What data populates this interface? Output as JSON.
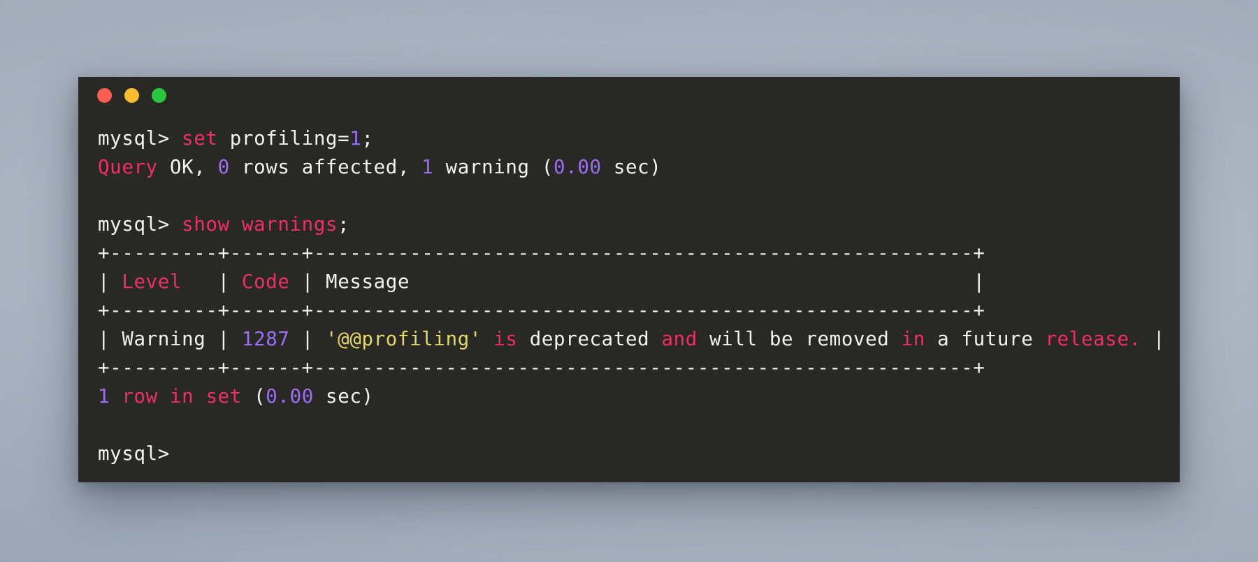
{
  "window": {
    "app": "Terminal",
    "background_color": "#282824",
    "controls": [
      {
        "name": "close",
        "color": "#ff5e52"
      },
      {
        "name": "minimize",
        "color": "#fbbd2e"
      },
      {
        "name": "maximize",
        "color": "#28c83e"
      }
    ]
  },
  "theme": {
    "foreground": "#f2f2ee",
    "keyword": "#ef2e63",
    "number": "#9b6ef3",
    "string": "#e5d769",
    "desktop": "#a5b0bd"
  },
  "terminal": {
    "prompt": "mysql>",
    "lines": [
      {
        "id": "cmd-set-profiling",
        "segments": [
          {
            "text": "mysql> ",
            "style": "pl"
          },
          {
            "text": "set",
            "style": "kw"
          },
          {
            "text": " profiling=",
            "style": "pl"
          },
          {
            "text": "1",
            "style": "num"
          },
          {
            "text": ";",
            "style": "pl"
          }
        ]
      },
      {
        "id": "result-query-ok",
        "segments": [
          {
            "text": "Query",
            "style": "kw"
          },
          {
            "text": " OK, ",
            "style": "pl"
          },
          {
            "text": "0",
            "style": "num"
          },
          {
            "text": " rows affected, ",
            "style": "pl"
          },
          {
            "text": "1",
            "style": "num"
          },
          {
            "text": " warning (",
            "style": "pl"
          },
          {
            "text": "0.00",
            "style": "num"
          },
          {
            "text": " sec)",
            "style": "pl"
          }
        ]
      },
      {
        "id": "blank-1",
        "segments": [
          {
            "text": " ",
            "style": "pl"
          }
        ]
      },
      {
        "id": "cmd-show-warnings",
        "segments": [
          {
            "text": "mysql> ",
            "style": "pl"
          },
          {
            "text": "show warnings",
            "style": "kw"
          },
          {
            "text": ";",
            "style": "pl"
          }
        ]
      },
      {
        "id": "table-rule-top",
        "segments": [
          {
            "text": "+---------+------+-------------------------------------------------------+",
            "style": "pl"
          }
        ]
      },
      {
        "id": "table-header",
        "segments": [
          {
            "text": "| ",
            "style": "pl"
          },
          {
            "text": "Level",
            "style": "kw"
          },
          {
            "text": "   | ",
            "style": "pl"
          },
          {
            "text": "Code",
            "style": "kw"
          },
          {
            "text": " | Message",
            "style": "pl"
          },
          {
            "text": "                                               |",
            "style": "pl"
          }
        ]
      },
      {
        "id": "table-rule-mid",
        "segments": [
          {
            "text": "+---------+------+-------------------------------------------------------+",
            "style": "pl"
          }
        ]
      },
      {
        "id": "table-row-warning",
        "segments": [
          {
            "text": "| Warning | ",
            "style": "pl"
          },
          {
            "text": "1287",
            "style": "num"
          },
          {
            "text": " | ",
            "style": "pl"
          },
          {
            "text": "'@@profiling'",
            "style": "str"
          },
          {
            "text": " ",
            "style": "pl"
          },
          {
            "text": "is",
            "style": "kw"
          },
          {
            "text": " deprecated ",
            "style": "pl"
          },
          {
            "text": "and",
            "style": "kw"
          },
          {
            "text": " will be removed ",
            "style": "pl"
          },
          {
            "text": "in",
            "style": "kw"
          },
          {
            "text": " a future ",
            "style": "pl"
          },
          {
            "text": "release.",
            "style": "kw"
          },
          {
            "text": " |",
            "style": "pl"
          }
        ]
      },
      {
        "id": "table-rule-bottom",
        "segments": [
          {
            "text": "+---------+------+-------------------------------------------------------+",
            "style": "pl"
          }
        ]
      },
      {
        "id": "result-row-count",
        "segments": [
          {
            "text": "1",
            "style": "num"
          },
          {
            "text": " ",
            "style": "pl"
          },
          {
            "text": "row in set",
            "style": "kw"
          },
          {
            "text": " (",
            "style": "pl"
          },
          {
            "text": "0.00",
            "style": "num"
          },
          {
            "text": " sec)",
            "style": "pl"
          }
        ]
      },
      {
        "id": "blank-2",
        "segments": [
          {
            "text": " ",
            "style": "pl"
          }
        ]
      },
      {
        "id": "prompt-idle",
        "segments": [
          {
            "text": "mysql>",
            "style": "pl"
          }
        ]
      }
    ],
    "table": {
      "columns": [
        "Level",
        "Code",
        "Message"
      ],
      "rows": [
        [
          "Warning",
          "1287",
          "'@@profiling' is deprecated and will be removed in a future release."
        ]
      ],
      "row_count_text": "1 row in set (0.00 sec)"
    }
  }
}
